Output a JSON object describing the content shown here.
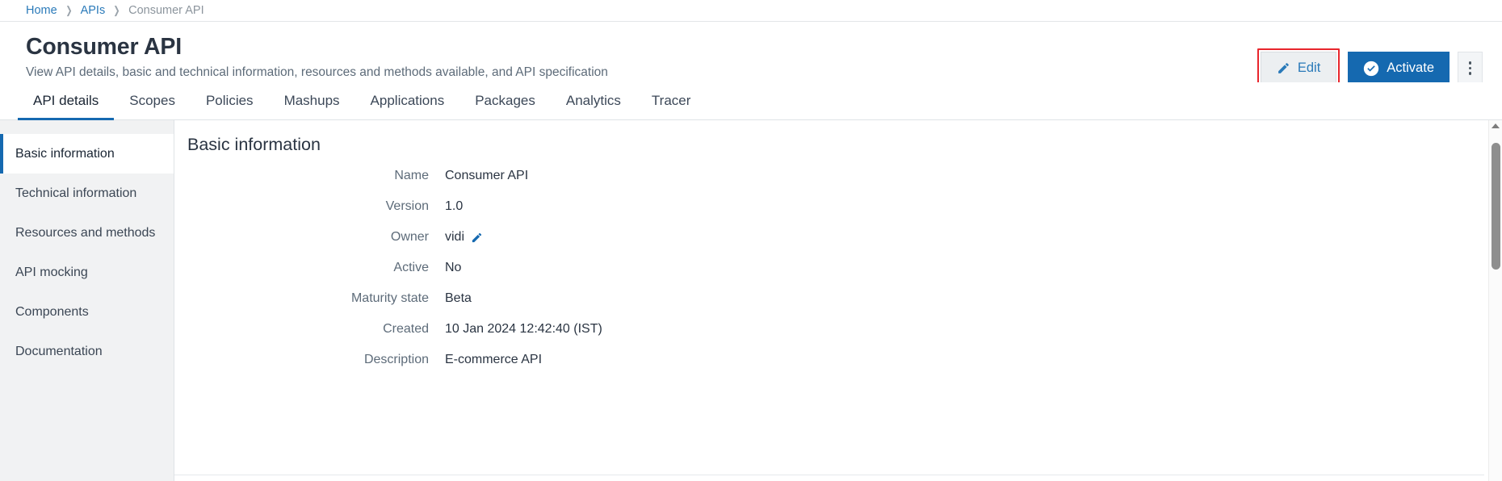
{
  "breadcrumb": {
    "items": [
      {
        "label": "Home",
        "link": true
      },
      {
        "label": "APIs",
        "link": true
      },
      {
        "label": "Consumer API",
        "link": false
      }
    ],
    "separator": "❯"
  },
  "header": {
    "title": "Consumer API",
    "subtitle": "View API details, basic and technical information, resources and methods available, and API specification",
    "actions": {
      "edit_label": "Edit",
      "edit_icon": "pencil-icon",
      "edit_highlight_color": "#e8262d",
      "activate_label": "Activate",
      "activate_icon": "check-circle-icon",
      "activate_color": "#1569b0",
      "more_icon": "kebab-menu-icon"
    }
  },
  "tabs": {
    "active_index": 0,
    "accent_color": "#1569b0",
    "items": [
      {
        "label": "API details"
      },
      {
        "label": "Scopes"
      },
      {
        "label": "Policies"
      },
      {
        "label": "Mashups"
      },
      {
        "label": "Applications"
      },
      {
        "label": "Packages"
      },
      {
        "label": "Analytics"
      },
      {
        "label": "Tracer"
      }
    ]
  },
  "sidenav": {
    "active_index": 0,
    "accent_color": "#1569b0",
    "items": [
      {
        "label": "Basic information"
      },
      {
        "label": "Technical information"
      },
      {
        "label": "Resources and methods"
      },
      {
        "label": "API mocking"
      },
      {
        "label": "Components"
      },
      {
        "label": "Documentation"
      }
    ]
  },
  "main": {
    "section_title": "Basic information",
    "fields": [
      {
        "label": "Name",
        "value": "Consumer API",
        "editable": false
      },
      {
        "label": "Version",
        "value": "1.0",
        "editable": false
      },
      {
        "label": "Owner",
        "value": "vidi",
        "editable": true,
        "edit_icon": "pencil-icon"
      },
      {
        "label": "Active",
        "value": "No",
        "editable": false
      },
      {
        "label": "Maturity state",
        "value": "Beta",
        "editable": false
      },
      {
        "label": "Created",
        "value": "10 Jan 2024 12:42:40 (IST)",
        "editable": false
      },
      {
        "label": "Description",
        "value": "E-commerce API",
        "editable": false
      }
    ]
  },
  "scrollbar": {
    "up_arrow_icon": "caret-up-icon",
    "thumb_position_percent": 6
  }
}
